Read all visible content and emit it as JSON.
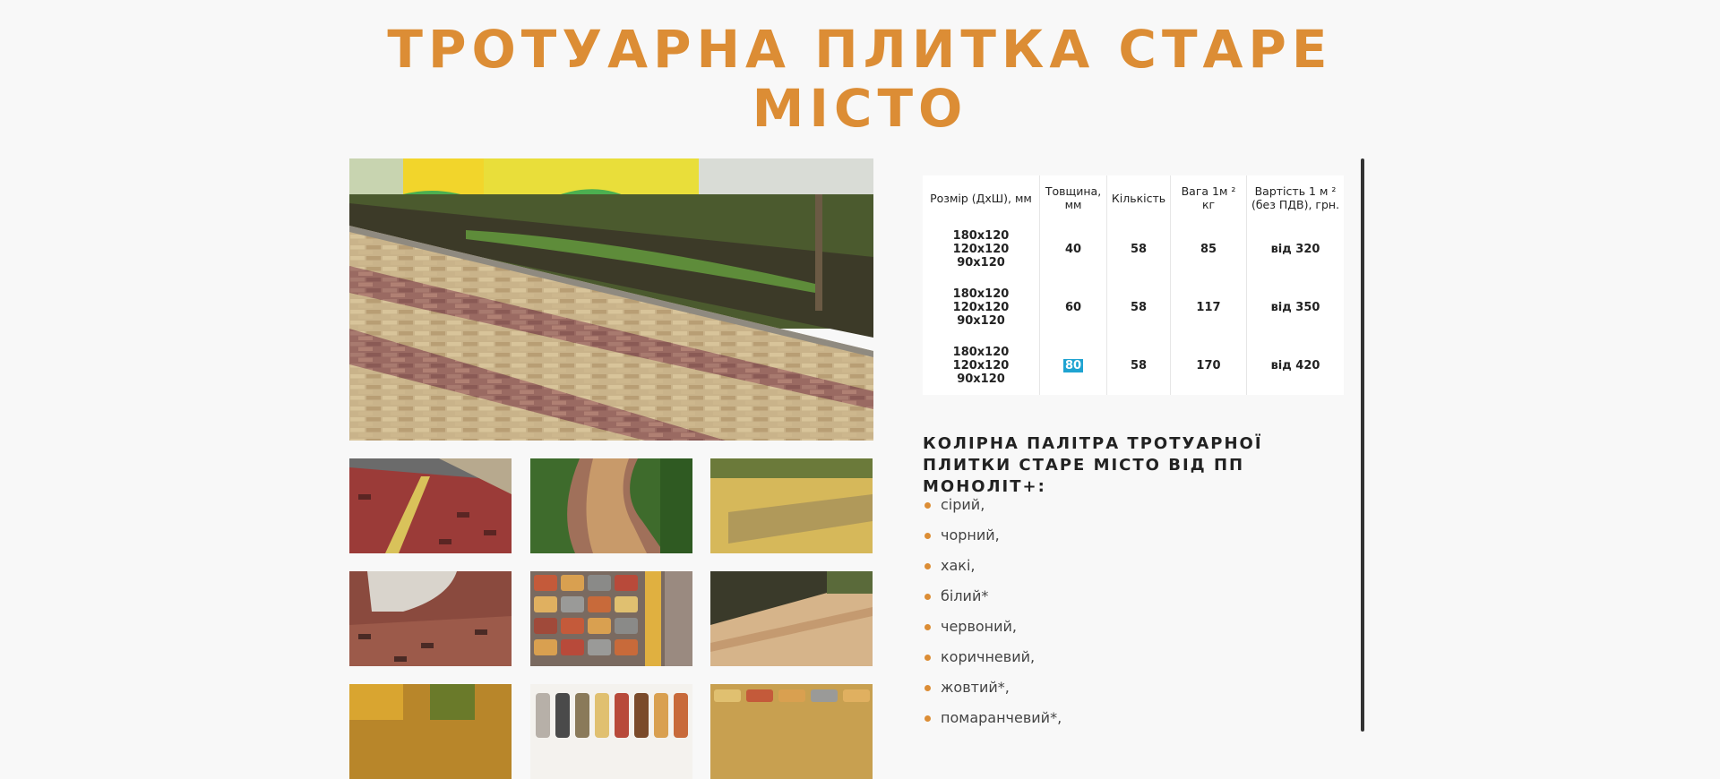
{
  "title": {
    "line1": "ТРОТУАРНА ПЛИТКА СТАРЕ",
    "line2": "МІСТО"
  },
  "table": {
    "headers": {
      "size": "Розмір (ДхШ), мм",
      "thickness": "Товщина, мм",
      "quantity": "Кількість",
      "weight": "Вага 1м ² кг",
      "price": "Вартість 1 м ² (без ПДВ), грн."
    },
    "rows": [
      {
        "size1": "180х120",
        "size2": "120х120",
        "size3": "90х120",
        "thickness": "40",
        "quantity": "58",
        "weight": "85",
        "price": "від 320"
      },
      {
        "size1": "180х120",
        "size2": "120х120",
        "size3": "90х120",
        "thickness": "60",
        "quantity": "58",
        "weight": "117",
        "price": "від 350"
      },
      {
        "size1": "180х120",
        "size2": "120х120",
        "size3": "90х120",
        "thickness": "80",
        "quantity": "58",
        "weight": "170",
        "price": "від 420"
      }
    ]
  },
  "palette": {
    "heading": "КОЛІРНА ПАЛІТРА ТРОТУАРНОЇ ПЛИТКИ СТАРЕ МІСТО ВІД ПП МОНОЛІТ+:",
    "colors": [
      "сірий,",
      "чорний,",
      "хакі,",
      "білий*",
      "червоний,",
      "коричневий,",
      "жовтий*,",
      "помаранчевий*,"
    ]
  },
  "colors": {
    "accent": "#dc8d35",
    "highlight": "#1fa3d1"
  }
}
